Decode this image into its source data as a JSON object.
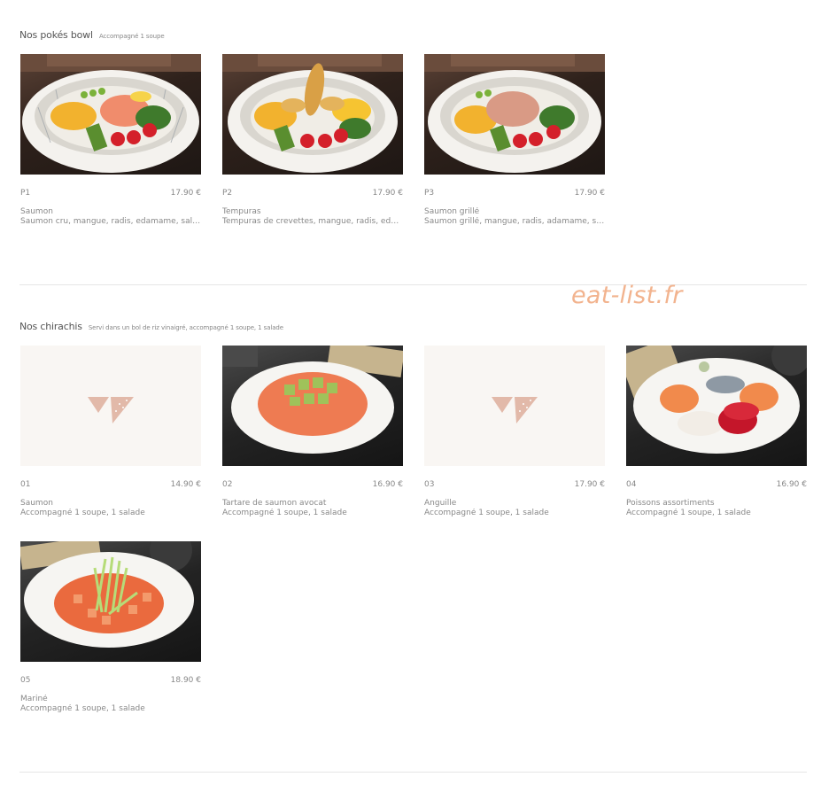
{
  "watermark": "eat-list.fr",
  "sections": [
    {
      "title": "Nos pokés bowl",
      "subtitle": "Accompagné 1 soupe",
      "items": [
        {
          "code": "P1",
          "price": "17.90 €",
          "name": "Saumon",
          "desc": "Saumon cru, mangue, radis, edamame, salade…",
          "image": "poke-bowl-salmon-photo"
        },
        {
          "code": "P2",
          "price": "17.90 €",
          "name": "Tempuras",
          "desc": "Tempuras de crevettes, mangue, radis, edama…",
          "image": "poke-bowl-tempura-photo"
        },
        {
          "code": "P3",
          "price": "17.90 €",
          "name": "Saumon grillé",
          "desc": "Saumon grillé, mangue, radis, adamame, salad…",
          "image": "poke-bowl-grilled-salmon-photo"
        }
      ]
    },
    {
      "title": "Nos chirachis",
      "subtitle": "Servi dans un bol de riz vinaigré, accompagné 1 soupe, 1 salade",
      "items": [
        {
          "code": "01",
          "price": "14.90 €",
          "name": "Saumon",
          "desc": "Accompagné 1 soupe, 1 salade",
          "image": "placeholder-logo"
        },
        {
          "code": "02",
          "price": "16.90 €",
          "name": "Tartare de saumon avocat",
          "desc": "Accompagné 1 soupe, 1 salade",
          "image": "salmon-avocado-tartare-photo"
        },
        {
          "code": "03",
          "price": "17.90 €",
          "name": "Anguille",
          "desc": "Accompagné 1 soupe, 1 salade",
          "image": "placeholder-logo"
        },
        {
          "code": "04",
          "price": "16.90 €",
          "name": "Poissons assortiments",
          "desc": "Accompagné 1 soupe, 1 salade",
          "image": "assorted-fish-chirashi-photo"
        },
        {
          "code": "05",
          "price": "18.90 €",
          "name": "Mariné",
          "desc": "Accompagné 1 soupe, 1 salade",
          "image": "marinated-chirashi-photo"
        }
      ]
    }
  ],
  "colors": {
    "watermark": "#f2b38e",
    "placeholder_bg": "#f9f6f3",
    "logo": "#e2b9a9"
  }
}
